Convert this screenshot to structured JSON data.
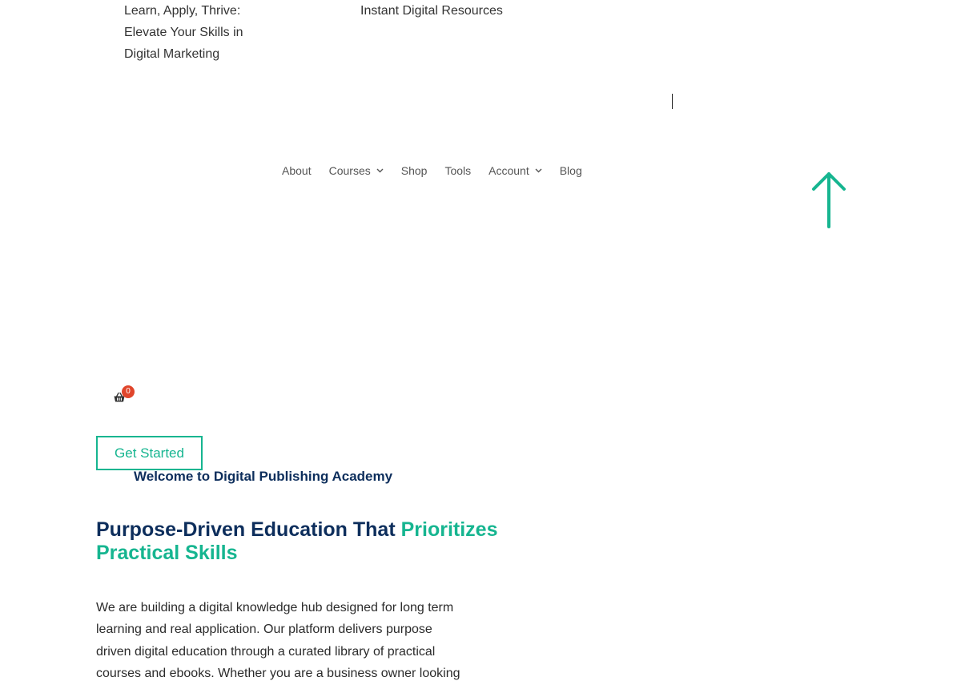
{
  "header": {
    "tagline_lines": [
      "Learn, Apply, Thrive:",
      "Elevate Your Skills in",
      "Digital Marketing"
    ],
    "resources_label": "Instant Digital Resources"
  },
  "nav": {
    "items": [
      {
        "label": "About",
        "has_dropdown": false
      },
      {
        "label": "Courses",
        "has_dropdown": true
      },
      {
        "label": "Shop",
        "has_dropdown": false
      },
      {
        "label": "Tools",
        "has_dropdown": false
      },
      {
        "label": "Account",
        "has_dropdown": true
      },
      {
        "label": "Blog",
        "has_dropdown": false
      }
    ]
  },
  "scroll_top": {
    "icon": "arrow-up-icon",
    "color": "#16b590"
  },
  "cart": {
    "icon": "basket-icon",
    "count": "0",
    "badge_color": "#e0452b"
  },
  "hero": {
    "cta_label": "Get Started",
    "welcome": "Welcome to Digital Publishing Academy",
    "headline_main": "Purpose-Driven Education That ",
    "headline_accent": "Prioritizes Practical Skills",
    "intro_lines": [
      "We are building a digital knowledge hub designed for long term",
      "learning and real application. Our platform delivers purpose",
      "driven digital education through a curated library of practical",
      "courses and ebooks. Whether you are a business owner looking"
    ]
  },
  "colors": {
    "accent": "#16b590",
    "navy": "#0d2e5c",
    "badge": "#e0452b"
  }
}
